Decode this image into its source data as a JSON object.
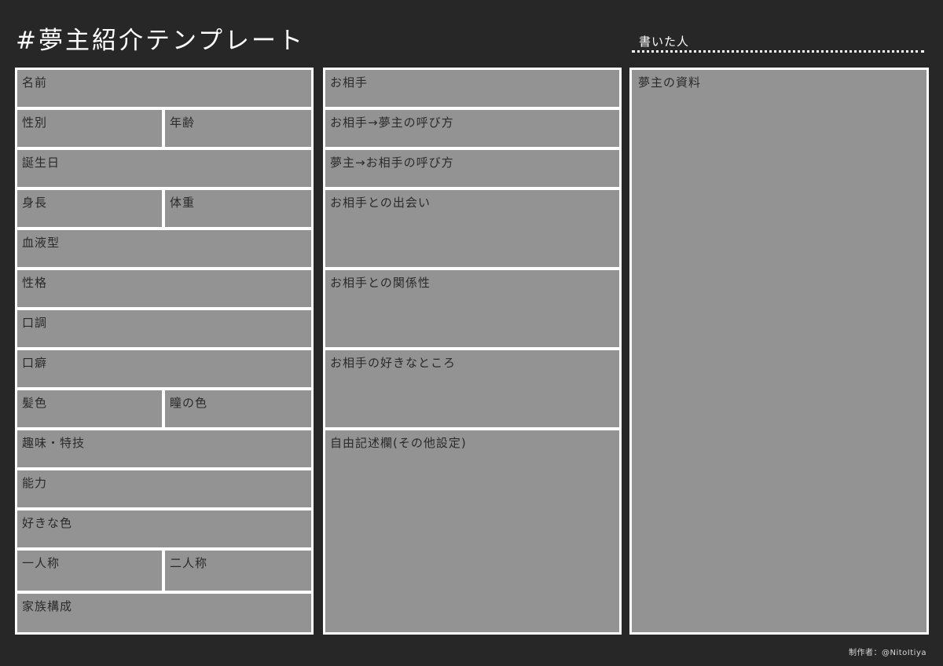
{
  "title": "#夢主紹介テンプレート",
  "author_label": "書いた人",
  "left_column": {
    "name": "名前",
    "gender": "性別",
    "age": "年齢",
    "birthday": "誕生日",
    "height": "身長",
    "weight": "体重",
    "blood_type": "血液型",
    "personality": "性格",
    "speech": "口調",
    "habit": "口癖",
    "hair_color": "髪色",
    "eye_color": "瞳の色",
    "hobby": "趣味・特技",
    "ability": "能力",
    "favorite_color": "好きな色",
    "first_person": "一人称",
    "second_person": "二人称",
    "family": "家族構成"
  },
  "middle_column": {
    "partner": "お相手",
    "partner_to_yume": "お相手→夢主の呼び方",
    "yume_to_partner": "夢主→お相手の呼び方",
    "meeting": "お相手との出会い",
    "relationship": "お相手との関係性",
    "likes": "お相手の好きなところ",
    "free": "自由記述欄(その他設定)"
  },
  "right_column": {
    "materials": "夢主の資料"
  },
  "credit": "制作者：@NitoItiya",
  "colors": {
    "background": "#272727",
    "cell": "#939393",
    "border": "#ffffff"
  }
}
